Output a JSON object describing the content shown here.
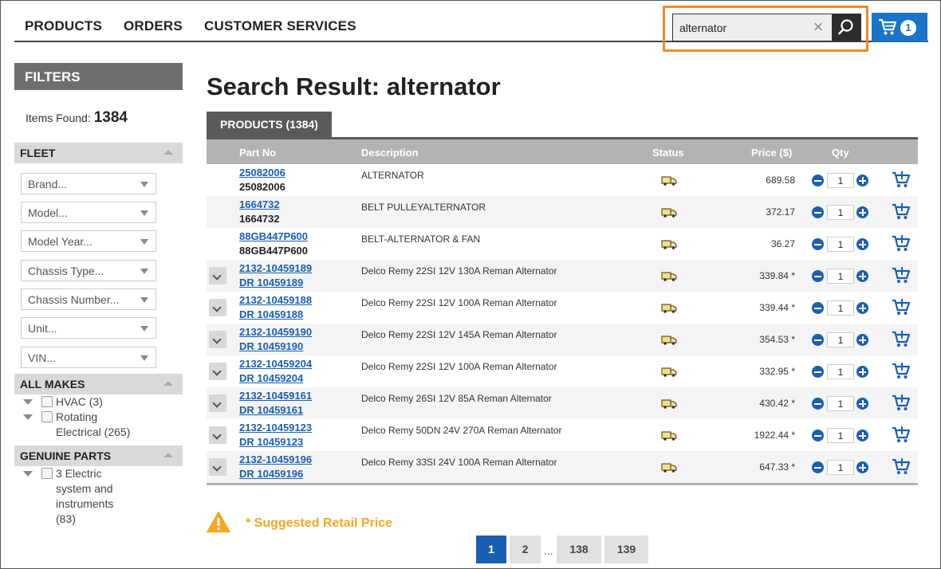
{
  "nav": {
    "items": [
      "PRODUCTS",
      "ORDERS",
      "CUSTOMER SERVICES"
    ]
  },
  "search": {
    "value": "alternator"
  },
  "cart": {
    "count": "1",
    "color": "#1a73c8"
  },
  "sidebar": {
    "filters_title": "FILTERS",
    "items_found_label": "Items Found:",
    "items_found_count": "1384",
    "fleet_title": "FLEET",
    "fleet_selects": [
      "Brand...",
      "Model...",
      "Model Year...",
      "Chassis Type...",
      "Chassis Number...",
      "Unit...",
      "VIN..."
    ],
    "all_makes_title": "ALL MAKES",
    "all_makes_items": [
      "HVAC (3)",
      "Rotating Electrical (265)"
    ],
    "genuine_parts_title": "GENUINE PARTS",
    "genuine_parts_items": [
      "3 Electric system and instruments (83)"
    ]
  },
  "main": {
    "title": "Search Result: alternator",
    "tab_label": "PRODUCTS (1384)",
    "columns": {
      "part_no": "Part No",
      "description": "Description",
      "status": "Status",
      "price": "Price ($)",
      "qty": "Qty"
    },
    "rows": [
      {
        "link": "25082006",
        "sub": "25082006",
        "sub_type": "plain",
        "desc": "ALTERNATOR",
        "price": "689.58",
        "qty": "1",
        "expandable": false
      },
      {
        "link": "1664732",
        "sub": "1664732",
        "sub_type": "plain",
        "desc": "BELT PULLEYALTERNATOR",
        "price": "372.17",
        "qty": "1",
        "expandable": false
      },
      {
        "link": "88GB447P600",
        "sub": "88GB447P600",
        "sub_type": "plain",
        "desc": "BELT-ALTERNATOR & FAN",
        "price": "36.27",
        "qty": "1",
        "expandable": false
      },
      {
        "link": "2132-10459189",
        "sub": "DR 10459189",
        "sub_type": "link",
        "desc": "Delco Remy 22SI 12V 130A Reman Alternator",
        "price": "339.84 *",
        "qty": "1",
        "expandable": true
      },
      {
        "link": "2132-10459188",
        "sub": "DR 10459188",
        "sub_type": "link",
        "desc": "Delco Remy 22SI 12V 100A Reman Alternator",
        "price": "339.44 *",
        "qty": "1",
        "expandable": true
      },
      {
        "link": "2132-10459190",
        "sub": "DR 10459190",
        "sub_type": "link",
        "desc": "Delco Remy 22SI 12V 145A Reman Alternator",
        "price": "354.53 *",
        "qty": "1",
        "expandable": true
      },
      {
        "link": "2132-10459204",
        "sub": "DR 10459204",
        "sub_type": "link",
        "desc": "Delco Remy 22SI 12V 100A Reman Alternator",
        "price": "332.95 *",
        "qty": "1",
        "expandable": true
      },
      {
        "link": "2132-10459161",
        "sub": "DR 10459161",
        "sub_type": "link",
        "desc": "Delco Remy 26SI 12V 85A Reman Alternator",
        "price": "430.42 *",
        "qty": "1",
        "expandable": true
      },
      {
        "link": "2132-10459123",
        "sub": "DR 10459123",
        "sub_type": "link",
        "desc": "Delco Remy 50DN 24V 270A Reman Alternator",
        "price": "1922.44 *",
        "qty": "1",
        "expandable": true
      },
      {
        "link": "2132-10459196",
        "sub": "DR 10459196",
        "sub_type": "link",
        "desc": "Delco Remy 33SI 24V 100A Reman Alternator",
        "price": "647.33 *",
        "qty": "1",
        "expandable": true
      }
    ],
    "srp_note": "* Suggested Retail Price",
    "pagination": {
      "pages": [
        "1",
        "2",
        "138",
        "139"
      ],
      "active": "1",
      "ellipsis": "..."
    }
  },
  "colors": {
    "accent": "#1a5fb4",
    "highlight_outline": "#f08a24",
    "srp": "#f5a623"
  },
  "icons": {
    "search": "search-icon",
    "clear": "clear-icon",
    "cart": "cart-icon",
    "status": "status-truck-icon",
    "add_to_cart": "add-to-cart-icon",
    "warning": "warning-icon"
  }
}
